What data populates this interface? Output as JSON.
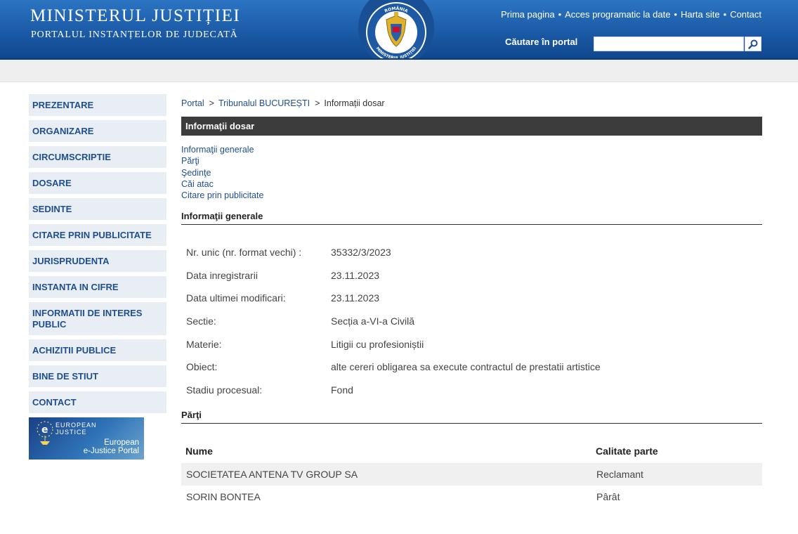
{
  "header": {
    "title": "MINISTERUL JUSTIȚIEI",
    "subtitle": "PORTALUL INSTANȚELOR DE JUDECATĂ",
    "nav": [
      "Prima pagina",
      "Acces programatic la date",
      "Harta site",
      "Contact"
    ],
    "nav_separator": "•",
    "search_label": "Căutare în portal",
    "search_value": "",
    "emblem_text_top": "ROMÂNIA",
    "emblem_text_bottom": "MINISTERUL JUSTIȚIEI",
    "colors": {
      "header_blue": "#1b5aa6",
      "link_blue": "#1f4f90",
      "bar_dark": "#3c3c3c"
    }
  },
  "sidebar": {
    "items": [
      "PREZENTARE",
      "ORGANIZARE",
      "CIRCUMSCRIPTIE",
      "DOSARE",
      "SEDINTE",
      "CITARE PRIN PUBLICITATE",
      "JURISPRUDENTA",
      "INSTANTA IN CIFRE",
      "INFORMATII DE INTERES PUBLIC",
      "ACHIZITII PUBLICE",
      "BINE DE STIUT",
      "CONTACT"
    ],
    "banner": {
      "top_line1": "EUROPEAN",
      "top_line2": "JUSTICE",
      "bottom_line1": "European",
      "bottom_line2": "e-Justice Portal"
    }
  },
  "breadcrumb": {
    "items": [
      "Portal",
      "Tribunalul BUCUREȘTI",
      "Informații dosar"
    ],
    "separator": ">"
  },
  "main": {
    "section_title": "Informaţii dosar",
    "sublinks": [
      "Informaţii generale",
      "Părţi",
      "Şedinţe",
      "Căi atac",
      "Citare prin publicitate"
    ],
    "general_heading": "Informaţii generale",
    "general_rows": [
      {
        "label": "Nr. unic (nr. format vechi) :",
        "value": "35332/3/2023"
      },
      {
        "label": "Data inregistrarii",
        "value": "23.11.2023"
      },
      {
        "label": "Data ultimei modificari:",
        "value": "23.11.2023"
      },
      {
        "label": "Sectie:",
        "value": "Secția a-VI-a Civilă"
      },
      {
        "label": "Materie:",
        "value": "Litigii cu profesioniștii"
      },
      {
        "label": "Obiect:",
        "value": "alte cereri obligarea sa execute contractul de prestatii artistice"
      },
      {
        "label": "Stadiu procesual:",
        "value": "Fond"
      }
    ],
    "parti_heading": "Părţi",
    "parti_columns": [
      "Nume",
      "Calitate parte"
    ],
    "parti_rows": [
      {
        "name": "SOCIETATEA ANTENA TV GROUP SA",
        "role": "Reclamant"
      },
      {
        "name": "SORIN BONTEA",
        "role": "Pârât"
      }
    ]
  }
}
